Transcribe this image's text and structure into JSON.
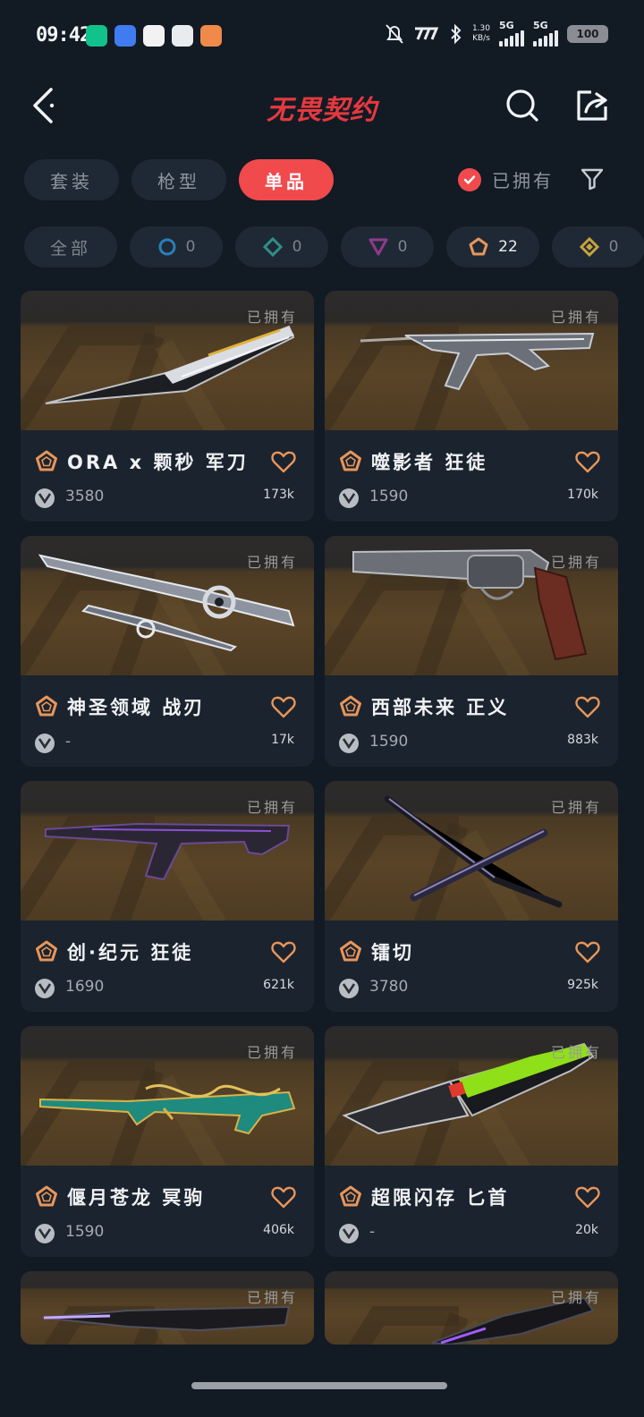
{
  "status_bar": {
    "time": "09:42",
    "network_speed_value": "1.30",
    "network_speed_unit": "KB/s",
    "signal_1": "5G",
    "signal_2": "5G",
    "battery": "100",
    "icons": [
      "bell-off-icon",
      "carrier-icon",
      "bluetooth-icon"
    ]
  },
  "header": {
    "title": "无畏契约",
    "back_icon": "chevron-left-icon",
    "search_icon": "search-icon",
    "share_icon": "share-icon"
  },
  "category_tabs": [
    {
      "label": "套装",
      "active": false
    },
    {
      "label": "枪型",
      "active": false
    },
    {
      "label": "单品",
      "active": true
    }
  ],
  "owned_filter": {
    "label": "已拥有",
    "checked": true
  },
  "rarity_filters": [
    {
      "label": "全部",
      "count": null
    },
    {
      "icon": "circle-tier-icon",
      "color": "#2a7fb8",
      "count": "0"
    },
    {
      "icon": "diamond-tier-icon",
      "color": "#2f8f86",
      "count": "0"
    },
    {
      "icon": "triangle-tier-icon",
      "color": "#8e3a8c",
      "count": "0"
    },
    {
      "icon": "pentagon-tier-icon",
      "color": "#e8965a",
      "count": "22"
    },
    {
      "icon": "gem-tier-icon",
      "color": "#c9a33c",
      "count": "0"
    }
  ],
  "owned_badge": "已拥有",
  "items": [
    {
      "name": "ORA x 颗秒 军刀",
      "price": "3580",
      "likes": "173k",
      "weapon": "knife"
    },
    {
      "name": "噬影者 狂徒",
      "price": "1590",
      "likes": "170k",
      "weapon": "rifle"
    },
    {
      "name": "神圣领域 战刃",
      "price": "-",
      "likes": "17k",
      "weapon": "blades"
    },
    {
      "name": "西部未来 正义",
      "price": "1590",
      "likes": "883k",
      "weapon": "revolver"
    },
    {
      "name": "创·纪元 狂徒",
      "price": "1690",
      "likes": "621k",
      "weapon": "rifle2"
    },
    {
      "name": "镭切",
      "price": "3780",
      "likes": "925k",
      "weapon": "swords"
    },
    {
      "name": "偃月苍龙 冥驹",
      "price": "1590",
      "likes": "406k",
      "weapon": "sniper"
    },
    {
      "name": "超限闪存 匕首",
      "price": "-",
      "likes": "20k",
      "weapon": "dagger"
    }
  ],
  "colors": {
    "background": "#121a24",
    "card": "#1b232e",
    "accent": "#f04a4d",
    "rarity_premium": "#e8965a"
  }
}
